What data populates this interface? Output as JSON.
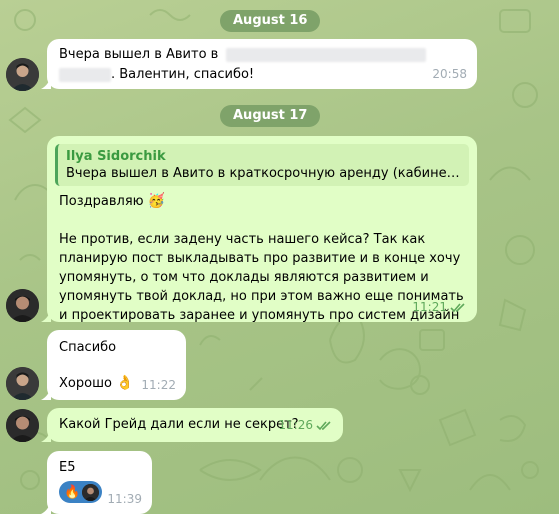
{
  "dates": {
    "first": "August 16",
    "second": "August 17"
  },
  "messages": [
    {
      "id": "m1",
      "direction": "in",
      "text_before": "Вчера вышел в Авито в",
      "text_after": ". Валентин, спасибо!",
      "time": "20:58"
    },
    {
      "id": "m2",
      "direction": "out",
      "reply_name": "Ilya Sidorchik",
      "reply_text": "Вчера вышел в Авито в краткосрочную аренду (кабинет хозя...",
      "line1": "Поздравляю",
      "line1_emoji": "🥳",
      "body": "Не против, если задену часть нашего кейса? Так как планирую пост выкладывать про развитие и в конце хочу упомянуть, о том что доклады являются развитием и упомянуть твой доклад, но при этом важно еще понимать и проектировать заранее и упомянуть про систем дизайн",
      "time": "11:21"
    },
    {
      "id": "m3",
      "direction": "in",
      "line1": "Спасибо",
      "line2": "Хорошо",
      "line2_emoji": "👌",
      "time": "11:22"
    },
    {
      "id": "m4",
      "direction": "out",
      "text": "Какой Грейд дали если не секрет?",
      "time": "11:26"
    },
    {
      "id": "m5",
      "direction": "in",
      "text": "E5",
      "reaction_emoji": "🔥",
      "time": "11:39"
    }
  ],
  "colors": {
    "incoming": "#ffffff",
    "outgoing": "#e1fec6",
    "date_pill": "#7fa36a",
    "read_check": "#5fa95b",
    "reaction_bg": "#3b82c4"
  },
  "icons": [
    "double-check-icon",
    "avatar",
    "fire-emoji",
    "ok-hand-emoji",
    "partying-face-emoji"
  ]
}
